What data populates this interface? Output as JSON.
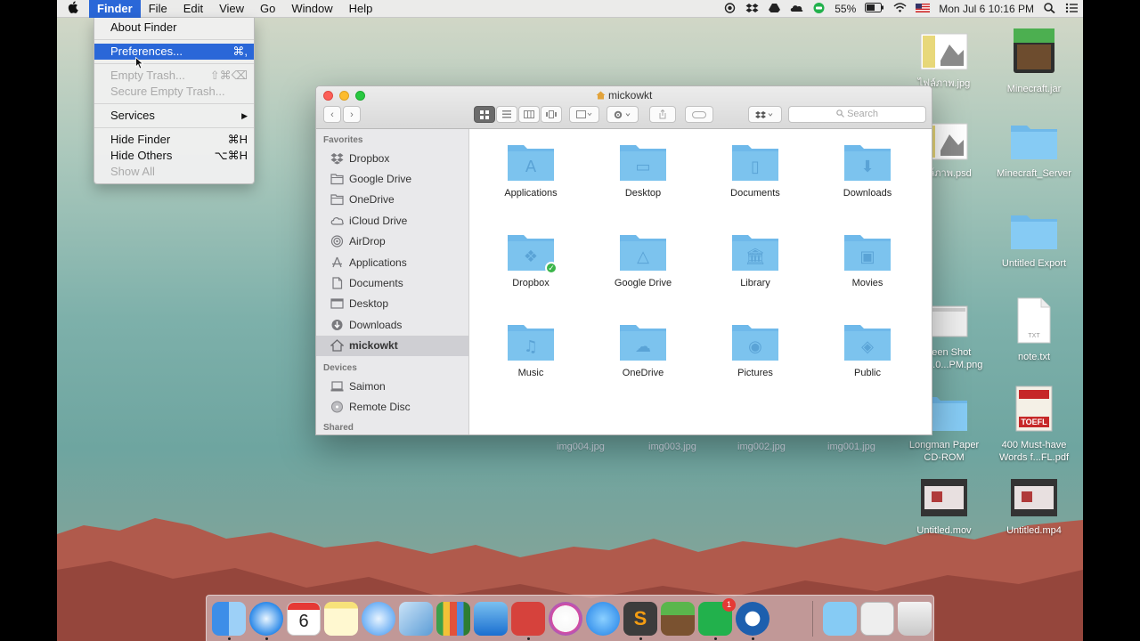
{
  "menubar": {
    "apple": "",
    "items": [
      "Finder",
      "File",
      "Edit",
      "View",
      "Go",
      "Window",
      "Help"
    ],
    "battery": "55%",
    "clock": "Mon Jul 6  10:16 PM"
  },
  "finder_menu": {
    "about": "About Finder",
    "preferences": "Preferences...",
    "preferences_shortcut": "⌘,",
    "empty_trash": "Empty Trash...",
    "empty_trash_shortcut": "⇧⌘⌫",
    "secure_empty": "Secure Empty Trash...",
    "services": "Services",
    "services_arrow": "▶",
    "hide_finder": "Hide Finder",
    "hide_finder_shortcut": "⌘H",
    "hide_others": "Hide Others",
    "hide_others_shortcut": "⌥⌘H",
    "show_all": "Show All"
  },
  "window": {
    "title": "mickowkt",
    "search_placeholder": "Search",
    "back": "‹",
    "forward": "›"
  },
  "sidebar": {
    "favorites_heading": "Favorites",
    "favorites": [
      {
        "label": "Dropbox",
        "icon": "dropbox-icon"
      },
      {
        "label": "Google Drive",
        "icon": "folder-icon"
      },
      {
        "label": "OneDrive",
        "icon": "folder-icon"
      },
      {
        "label": "iCloud Drive",
        "icon": "cloud-icon"
      },
      {
        "label": "AirDrop",
        "icon": "airdrop-icon"
      },
      {
        "label": "Applications",
        "icon": "applications-icon"
      },
      {
        "label": "Documents",
        "icon": "documents-icon"
      },
      {
        "label": "Desktop",
        "icon": "desktop-icon"
      },
      {
        "label": "Downloads",
        "icon": "downloads-icon"
      },
      {
        "label": "mickowkt",
        "icon": "home-icon"
      }
    ],
    "devices_heading": "Devices",
    "devices": [
      {
        "label": "Saimon",
        "icon": "computer-icon"
      },
      {
        "label": "Remote Disc",
        "icon": "disc-icon"
      }
    ],
    "shared_heading": "Shared"
  },
  "folders": [
    {
      "label": "Applications",
      "glyph": "A"
    },
    {
      "label": "Desktop",
      "glyph": "▭"
    },
    {
      "label": "Documents",
      "glyph": "▯"
    },
    {
      "label": "Downloads",
      "glyph": "⬇"
    },
    {
      "label": "Dropbox",
      "glyph": "❖"
    },
    {
      "label": "Google Drive",
      "glyph": "△"
    },
    {
      "label": "Library",
      "glyph": "🏛"
    },
    {
      "label": "Movies",
      "glyph": "▣"
    },
    {
      "label": "Music",
      "glyph": "♫"
    },
    {
      "label": "OneDrive",
      "glyph": "☁"
    },
    {
      "label": "Pictures",
      "glyph": "◉"
    },
    {
      "label": "Public",
      "glyph": "◈"
    }
  ],
  "desktop": {
    "icons": [
      {
        "label": "ไฟล์ภาพ.jpg"
      },
      {
        "label": "Minecraft.jar"
      },
      {
        "label": "ไฟล์ภาพ.psd"
      },
      {
        "label": "Minecraft_Server"
      },
      {
        "label": "Untitled Export"
      },
      {
        "label": "Screen Shot 2015...0...PM.png"
      },
      {
        "label": "note.txt"
      },
      {
        "label": "Longman Paper CD-ROM"
      },
      {
        "label": "400 Must-have Words f...FL.pdf"
      },
      {
        "label": "Untitled.mov"
      },
      {
        "label": "Untitled.mp4"
      }
    ],
    "ghost_files": [
      "img004.jpg",
      "img003.jpg",
      "img002.jpg",
      "img001.jpg"
    ],
    "minecraft_text": "MINECRAFT",
    "txt_badge": "TXT",
    "toefl_text": "TOEFL"
  },
  "dock": {
    "calendar_day": "6",
    "apps": [
      "finder",
      "safari",
      "calendar",
      "notes",
      "messages",
      "preview",
      "numbers",
      "keynote",
      "wunderlist",
      "itunes",
      "app-store",
      "sublime",
      "minecraft",
      "line",
      "quicktime",
      "downloads-stack",
      "documents-stack",
      "trash"
    ],
    "line_badge": "1"
  },
  "colors": {
    "accent": "#2a67d8",
    "folder": "#7cc3ee"
  }
}
